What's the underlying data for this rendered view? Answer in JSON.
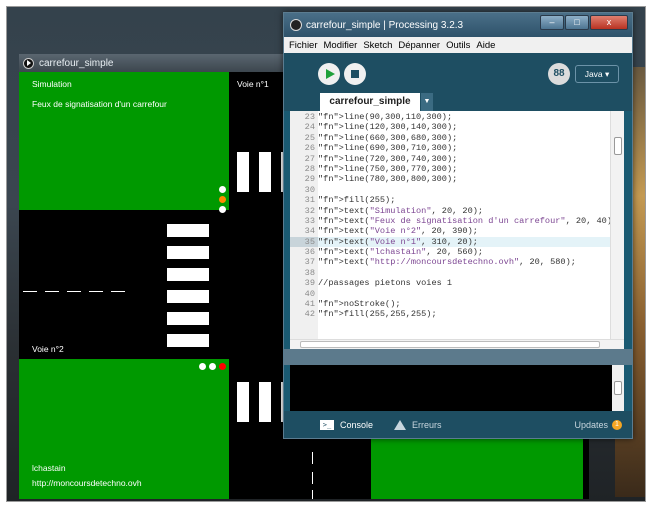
{
  "sketch_window": {
    "title": "carrefour_simple",
    "canvas_text": {
      "simulation": "Simulation",
      "subtitle": "Feux de signatisation d'un carrefour",
      "voie1": "Voie n°1",
      "voie2": "Voie n°2",
      "author": "lchastain",
      "url": "http://moncoursdetechno.ovh"
    },
    "light_colors": {
      "green": "#00cc00",
      "orange": "#ff8800",
      "red": "#ff0000",
      "off": "#ffffff"
    }
  },
  "ide": {
    "title": "carrefour_simple | Processing 3.2.3",
    "window_buttons": [
      "–",
      "□",
      "x"
    ],
    "menu": [
      "Fichier",
      "Modifier",
      "Sketch",
      "Dépanner",
      "Outils",
      "Aide"
    ],
    "mode": "Java ▾",
    "debug_label": "88",
    "tab": "carrefour_simple",
    "tab_menu": "▼",
    "code_lines": [
      {
        "n": "23",
        "t": "line(90,300,110,300);"
      },
      {
        "n": "24",
        "t": "line(120,300,140,300);"
      },
      {
        "n": "25",
        "t": "line(660,300,680,300);"
      },
      {
        "n": "26",
        "t": "line(690,300,710,300);"
      },
      {
        "n": "27",
        "t": "line(720,300,740,300);"
      },
      {
        "n": "28",
        "t": "line(750,300,770,300);"
      },
      {
        "n": "29",
        "t": "line(780,300,800,300);"
      },
      {
        "n": "30",
        "t": ""
      },
      {
        "n": "31",
        "t": "fill(255);"
      },
      {
        "n": "32",
        "t": "text(\"Simulation\", 20, 20);"
      },
      {
        "n": "33",
        "t": "text(\"Feux de signatisation d'un carrefour\", 20, 40);"
      },
      {
        "n": "34",
        "t": "text(\"Voie n°2\", 20, 390);"
      },
      {
        "n": "35",
        "t": "text(\"Voie n°1\", 310, 20);"
      },
      {
        "n": "36",
        "t": "text(\"lchastain\", 20, 560);"
      },
      {
        "n": "37",
        "t": "text(\"http://moncoursdetechno.ovh\", 20, 580);"
      },
      {
        "n": "38",
        "t": ""
      },
      {
        "n": "39",
        "t": "//passages pietons voies 1"
      },
      {
        "n": "40",
        "t": ""
      },
      {
        "n": "41",
        "t": "noStroke();"
      },
      {
        "n": "42",
        "t": "fill(255,255,255);"
      }
    ],
    "highlighted_line": "35",
    "console_label": "Console",
    "errors_label": "Erreurs",
    "updates_label": "Updates",
    "updates_count": "1"
  }
}
